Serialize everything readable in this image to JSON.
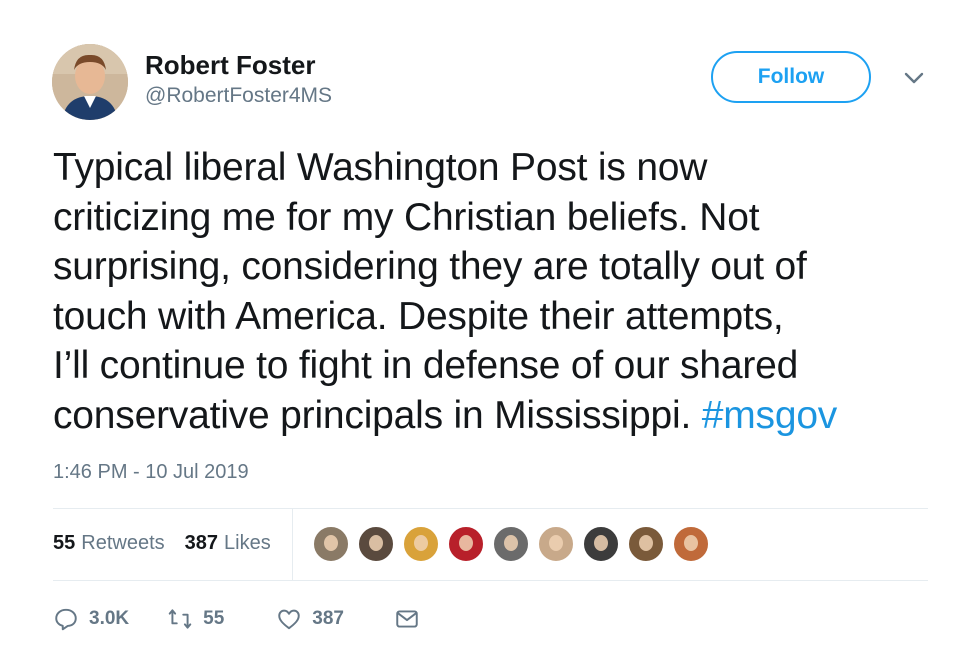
{
  "author": {
    "name": "Robert Foster",
    "handle": "@RobertFoster4MS"
  },
  "follow_button": {
    "label": "Follow"
  },
  "tweet": {
    "lines": [
      "Typical liberal Washington Post is now",
      "criticizing me for my Christian beliefs. Not",
      "surprising, considering they are totally out of",
      "touch with America. Despite their attempts,",
      "I’ll continue to fight in defense of our shared",
      "conservative principals in Mississippi. "
    ],
    "hashtag": "#msgov",
    "timestamp": "1:46 PM - 10 Jul 2019"
  },
  "stats": {
    "retweets_count": "55",
    "retweets_label": "Retweets",
    "likes_count": "387",
    "likes_label": "Likes"
  },
  "likers": [
    {
      "name": "liker-1",
      "color": "#8a7a66"
    },
    {
      "name": "liker-2",
      "color": "#5a4a3e"
    },
    {
      "name": "liker-3",
      "color": "#d9a23a"
    },
    {
      "name": "liker-4",
      "color": "#b8202a"
    },
    {
      "name": "liker-5",
      "color": "#6b6b6b"
    },
    {
      "name": "liker-6",
      "color": "#c8a98a"
    },
    {
      "name": "liker-7",
      "color": "#3c3c3c"
    },
    {
      "name": "liker-8",
      "color": "#7a5a3a"
    },
    {
      "name": "liker-9",
      "color": "#c06a3a"
    }
  ],
  "actions": {
    "reply_count": "3.0K",
    "retweet_count": "55",
    "like_count": "387"
  },
  "colors": {
    "accent": "#1da1f2",
    "hashtag": "#1b95e0",
    "secondary_text": "#657786",
    "divider": "#e6ecf0"
  },
  "icons": [
    "chevron-down-icon",
    "reply-icon",
    "retweet-icon",
    "heart-icon",
    "direct-message-icon"
  ]
}
